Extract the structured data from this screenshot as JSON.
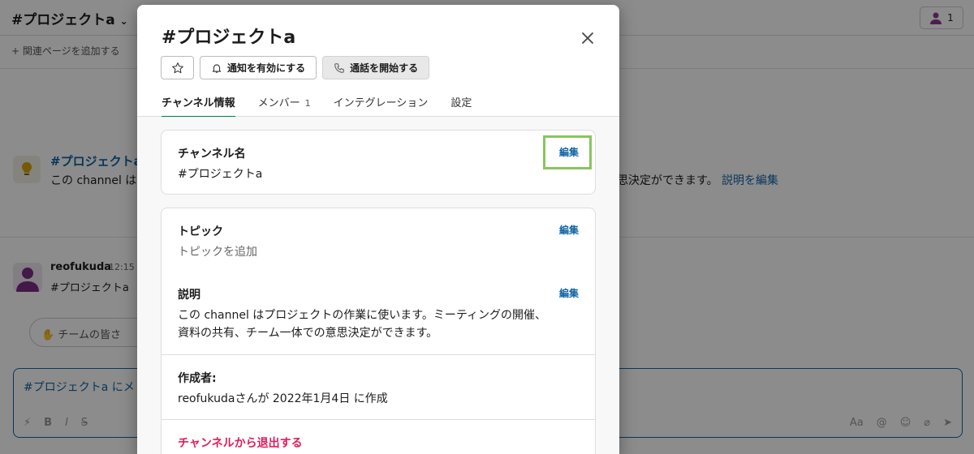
{
  "background": {
    "channel_title": "#プロジェクトa",
    "channel_chevron": "⌄",
    "member_count": "1",
    "add_bookmark": "+ 関連ページを追加する",
    "intro_title": "#プロジェクトa",
    "intro_text": "この channel は",
    "intro_right_text": "思決定ができます。",
    "intro_edit_link": "説明を編集",
    "message_author": "reofukuda",
    "message_time": "12:15",
    "message_text": "#プロジェクトa",
    "prompt_pill": "チームの皆さ",
    "composer_placeholder": "#プロジェクトa にメ",
    "toolbar_format_label": "Aa"
  },
  "modal": {
    "title": "#プロジェクトa",
    "close_label": "×",
    "buttons": {
      "notify_label": "通知を有効にする",
      "call_label": "通話を開始する"
    },
    "tabs": [
      {
        "label": "チャンネル情報"
      },
      {
        "label": "メンバー",
        "count": "1"
      },
      {
        "label": "インテグレーション"
      },
      {
        "label": "設定"
      }
    ],
    "channel_name": {
      "label": "チャンネル名",
      "value": "#プロジェクトa",
      "edit_label": "編集"
    },
    "topic": {
      "label": "トピック",
      "value": "トピックを追加",
      "edit_label": "編集"
    },
    "description": {
      "label": "説明",
      "line1": "この channel はプロジェクトの作業に使います。ミーティングの開催、",
      "line2": "資料の共有、チーム一体での意思決定ができます。",
      "edit_label": "編集"
    },
    "creator": {
      "label": "作成者:",
      "value": "reofukudaさんが 2022年1月4日 に作成"
    },
    "leave_label": "チャンネルから退出する"
  },
  "colors": {
    "accent_green": "#007a5a",
    "link_blue": "#1264a3",
    "danger": "#e01e5a",
    "highlight": "#86c75b"
  }
}
